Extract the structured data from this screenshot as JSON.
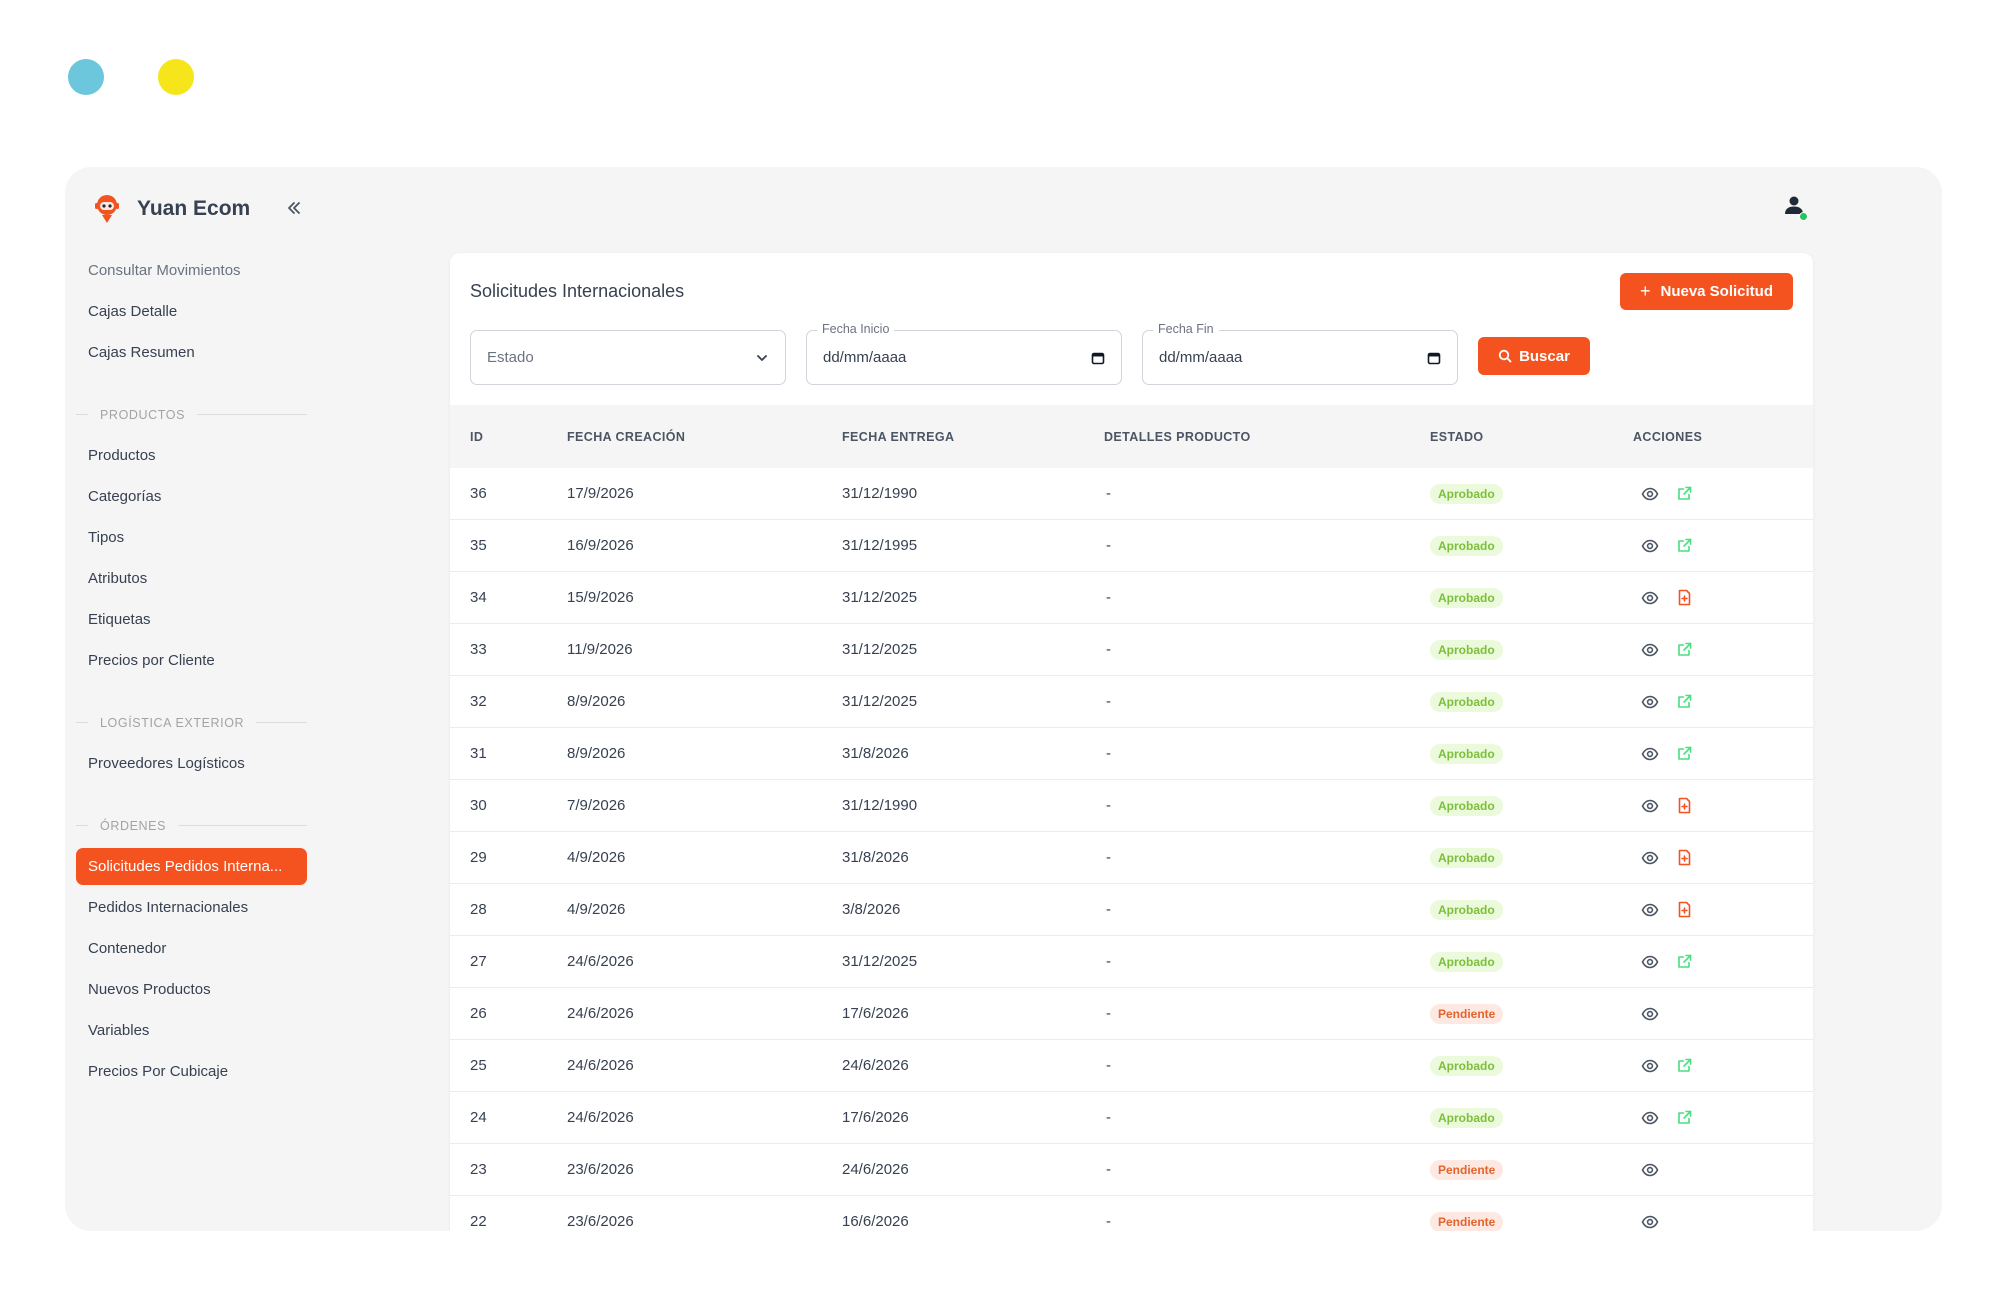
{
  "brand": {
    "name": "Yuan Ecom"
  },
  "nav": {
    "top_items": [
      "Consultar Movimientos",
      "Cajas Detalle",
      "Cajas Resumen"
    ],
    "sections": [
      {
        "title": "PRODUCTOS",
        "items": [
          "Productos",
          "Categorías",
          "Tipos",
          "Atributos",
          "Etiquetas",
          "Precios por Cliente"
        ]
      },
      {
        "title": "LOGÍSTICA EXTERIOR",
        "items": [
          "Proveedores Logísticos"
        ]
      },
      {
        "title": "ÓRDENES",
        "items": [
          "Solicitudes Pedidos Interna...",
          "Pedidos Internacionales",
          "Contenedor",
          "Nuevos Productos",
          "Variables",
          "Precios Por Cubicaje"
        ],
        "active_index": 0
      }
    ]
  },
  "page": {
    "title": "Solicitudes Internacionales",
    "new_button": "Nueva Solicitud",
    "new_button_icon": "+",
    "filters": {
      "estado_placeholder": "Estado",
      "fecha_inicio_label": "Fecha Inicio",
      "fecha_inicio_value": "dd/mm/aaaa",
      "fecha_fin_label": "Fecha Fin",
      "fecha_fin_value": "dd/mm/aaaa",
      "search_button": "Buscar"
    }
  },
  "table": {
    "headers": {
      "id": "ID",
      "fecha_creacion": "FECHA CREACIÓN",
      "fecha_entrega": "FECHA ENTREGA",
      "detalles": "DETALLES PRODUCTO",
      "estado": "ESTADO",
      "acciones": "ACCIONES"
    },
    "rows": [
      {
        "id": "36",
        "creacion": "17/9/2026",
        "entrega": "31/12/1990",
        "detalles": "-",
        "estado": "Aprobado",
        "second_action": "external-link-icon"
      },
      {
        "id": "35",
        "creacion": "16/9/2026",
        "entrega": "31/12/1995",
        "detalles": "-",
        "estado": "Aprobado",
        "second_action": "external-link-icon"
      },
      {
        "id": "34",
        "creacion": "15/9/2026",
        "entrega": "31/12/2025",
        "detalles": "-",
        "estado": "Aprobado",
        "second_action": "file-add-icon"
      },
      {
        "id": "33",
        "creacion": "11/9/2026",
        "entrega": "31/12/2025",
        "detalles": "-",
        "estado": "Aprobado",
        "second_action": "external-link-icon"
      },
      {
        "id": "32",
        "creacion": "8/9/2026",
        "entrega": "31/12/2025",
        "detalles": "-",
        "estado": "Aprobado",
        "second_action": "external-link-icon"
      },
      {
        "id": "31",
        "creacion": "8/9/2026",
        "entrega": "31/8/2026",
        "detalles": "-",
        "estado": "Aprobado",
        "second_action": "external-link-icon"
      },
      {
        "id": "30",
        "creacion": "7/9/2026",
        "entrega": "31/12/1990",
        "detalles": "-",
        "estado": "Aprobado",
        "second_action": "file-add-icon"
      },
      {
        "id": "29",
        "creacion": "4/9/2026",
        "entrega": "31/8/2026",
        "detalles": "-",
        "estado": "Aprobado",
        "second_action": "file-add-icon"
      },
      {
        "id": "28",
        "creacion": "4/9/2026",
        "entrega": "3/8/2026",
        "detalles": "-",
        "estado": "Aprobado",
        "second_action": "file-add-icon"
      },
      {
        "id": "27",
        "creacion": "24/6/2026",
        "entrega": "31/12/2025",
        "detalles": "-",
        "estado": "Aprobado",
        "second_action": "external-link-icon"
      },
      {
        "id": "26",
        "creacion": "24/6/2026",
        "entrega": "17/6/2026",
        "detalles": "-",
        "estado": "Pendiente",
        "second_action": ""
      },
      {
        "id": "25",
        "creacion": "24/6/2026",
        "entrega": "24/6/2026",
        "detalles": "-",
        "estado": "Aprobado",
        "second_action": "external-link-icon"
      },
      {
        "id": "24",
        "creacion": "24/6/2026",
        "entrega": "17/6/2026",
        "detalles": "-",
        "estado": "Aprobado",
        "second_action": "external-link-icon"
      },
      {
        "id": "23",
        "creacion": "23/6/2026",
        "entrega": "24/6/2026",
        "detalles": "-",
        "estado": "Pendiente",
        "second_action": ""
      },
      {
        "id": "22",
        "creacion": "23/6/2026",
        "entrega": "16/6/2026",
        "detalles": "-",
        "estado": "Pendiente",
        "second_action": ""
      }
    ]
  },
  "colors": {
    "accent": "#f4531f",
    "approved_text": "#7bbf3a",
    "approved_bg": "#ecfadc",
    "pending_text": "#e3642f",
    "pending_bg": "#fde8e2",
    "link_icon": "#4ade80",
    "file_icon": "#f4531f"
  }
}
